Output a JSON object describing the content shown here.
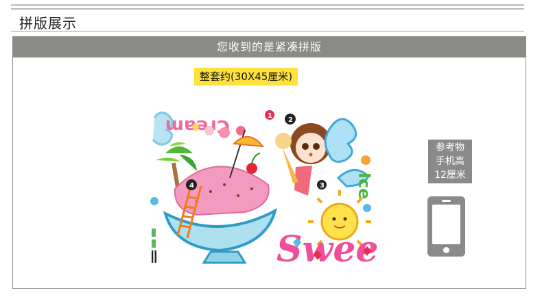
{
  "section": {
    "title": "拼版展示"
  },
  "panel": {
    "banner": "您收到的是紧凑拼版",
    "size_tag": "整套约(30X45厘米)"
  },
  "artwork": {
    "texts": {
      "cream": "Cream",
      "ice": "Ice",
      "sweet": "Sweet"
    },
    "numbers": [
      "2",
      "1",
      "4",
      "3"
    ]
  },
  "reference": {
    "lines": [
      "参考物",
      "手机高",
      "12厘米"
    ],
    "icon": "phone-icon"
  }
}
